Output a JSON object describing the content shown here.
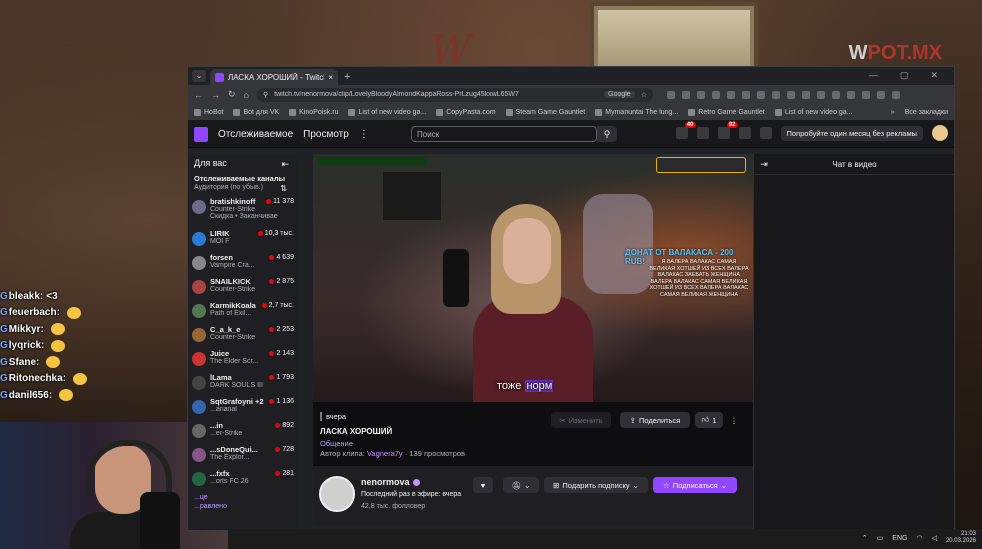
{
  "background": {
    "watermark_logo": "POT.MX",
    "overlay_chat": [
      {
        "user": "bleakk",
        "message": "<3"
      },
      {
        "user": "feuerbach",
        "message": ""
      },
      {
        "user": "Mikkyr",
        "message": ""
      },
      {
        "user": "lyqrick",
        "message": ""
      },
      {
        "user": "Sfane",
        "message": ""
      },
      {
        "user": "Ritonechka",
        "message": ""
      },
      {
        "user": "danil656",
        "message": ""
      }
    ]
  },
  "browser": {
    "tab_title": "ЛАСКА ХОРОШИЙ - Twitch",
    "url": "twitch.tv/nenormova/clip/LovelyBloodyAlmondKappaRoss-PrLzug45kxwL65W7",
    "google_chip": "Google",
    "bookmarks": [
      "HoBot",
      "Bot для VK",
      "KinoPoisk.ru",
      "List of new video ga...",
      "CopyPasta.com",
      "Steam Game Gauntlet",
      "Mymanuntai The lung...",
      "Retro Game Gauntlet",
      "List of new video ga..."
    ],
    "bookmarks_more": "»",
    "all_bookmarks": "Все закладки"
  },
  "twitch": {
    "nav": {
      "following": "Отслеживаемое",
      "browse": "Просмотр",
      "more": "⋮",
      "search_placeholder": "Поиск",
      "notif_count_1": "40",
      "notif_count_2": "92",
      "promo": "Попробуйте один месяц без рекламы"
    },
    "sidebar": {
      "title": "Для вас",
      "section": "Отслеживаемые каналы",
      "sort": "Аудитория (по убыв.)",
      "channels": [
        {
          "name": "bratishkinoff",
          "game": "Counter-Strike",
          "viewers": "11 378",
          "extra": "Скидка • Заканчивае"
        },
        {
          "name": "LIRIK",
          "game": "MOI F",
          "viewers": "10,3 тыс."
        },
        {
          "name": "forsen",
          "game": "Vampire Cra...",
          "viewers": "4 639"
        },
        {
          "name": "SNAILKICK",
          "game": "Counter-Strike",
          "viewers": "2 875"
        },
        {
          "name": "KarmikKoala",
          "game": "Path of Exil...",
          "viewers": "2,7 тыс."
        },
        {
          "name": "C_a_k_e",
          "game": "Counter-Strike",
          "viewers": "2 253"
        },
        {
          "name": "Juice",
          "game": "The Elder Scr...",
          "viewers": "2 143"
        },
        {
          "name": "lLama",
          "game": "DARK SOULS III",
          "viewers": "1 793"
        },
        {
          "name": "SqtGrafoyni +2",
          "game": "...ananal",
          "viewers": "1 136"
        },
        {
          "name": "...in",
          "game": "...er-Strike",
          "viewers": "892"
        },
        {
          "name": "...sDoneQui...",
          "game": "The Explor...",
          "viewers": "728"
        },
        {
          "name": "...fxfx",
          "game": "...orts FC 26",
          "viewers": "281"
        }
      ],
      "more": "...це",
      "less": "...равлено"
    },
    "player": {
      "donate_title": "ДОНАТ ОТ ВАЛАКАСА - 200 RUB!",
      "donate_text": "Я ВАЛЕРА ВАЛАКАС САМАЯ ВЕЛИКАЯ ХОТШЕЙ ИЗ ВСЕХ ВАЛЕРА ВАЛАКАС ЗАЕБАТЬ ЖЕНЩИНА ВАЛЕРА ВАЛАКАС САМАЯ ВЕЛИКАЯ ХОТШЕЙ ИЗ ВСЕХ ВАЛЕРА ВАЛАКАС САМАЯ ВЕЛИКАЯ ЖЕНЩИНА",
      "caption_before": "тоже ",
      "caption_hl": "норм"
    },
    "clip": {
      "when": "вчера",
      "title": "ЛАСКА ХОРОШИЙ",
      "category": "Общение",
      "author_label": "Автор клипа:",
      "author": "Vagnera7y",
      "views": "· 139 просмотров",
      "edit": "Изменить",
      "share": "Поделиться",
      "likes": "1",
      "more": "⋮"
    },
    "channel": {
      "name": "nenormova",
      "last_live": "Последний раз в эфире: вчера",
      "followers": "42,8 тыс. фолловер",
      "gift": "Подарить подписку",
      "subscribe": "Подписаться"
    },
    "chat": {
      "title": "Чат в видео"
    }
  },
  "taskbar": {
    "lang": "ENG",
    "time": "21:03",
    "date": "20.03.2026"
  }
}
